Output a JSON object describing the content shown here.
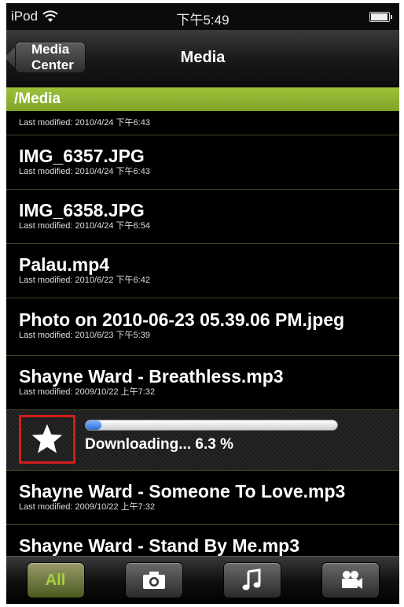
{
  "status": {
    "carrier": "iPod",
    "time": "下午5:49"
  },
  "navbar": {
    "back_label": "Media Center",
    "title": "Media"
  },
  "path": "/Media",
  "first_row_meta": "Last modified: 2010/4/24 下午6:43",
  "files": [
    {
      "name": "IMG_6357.JPG",
      "meta": "Last modified: 2010/4/24 下午6:43"
    },
    {
      "name": "IMG_6358.JPG",
      "meta": "Last modified: 2010/4/24 下午6:54"
    },
    {
      "name": "Palau.mp4",
      "meta": "Last modified: 2010/6/22 下午6:42"
    },
    {
      "name": "Photo on 2010-06-23 05.39.06 PM.jpeg",
      "meta": "Last modified: 2010/6/23 下午5:39"
    },
    {
      "name": "Shayne Ward - Breathless.mp3",
      "meta": "Last modified: 2009/10/22 上午7:32"
    }
  ],
  "download": {
    "text": "Downloading... 6.3 %",
    "progress": 0.063
  },
  "files_after": [
    {
      "name": "Shayne Ward - Someone To Love.mp3",
      "meta": "Last modified: 2009/10/22 上午7:32"
    },
    {
      "name": "Shayne Ward - Stand By Me.mp3"
    }
  ],
  "tabs": {
    "all": "All",
    "photos_icon": "camera-icon",
    "music_icon": "music-note-icon",
    "video_icon": "video-camera-icon"
  },
  "colors": {
    "accent_green": "#8fb832",
    "highlight_red": "#d21d1d"
  }
}
